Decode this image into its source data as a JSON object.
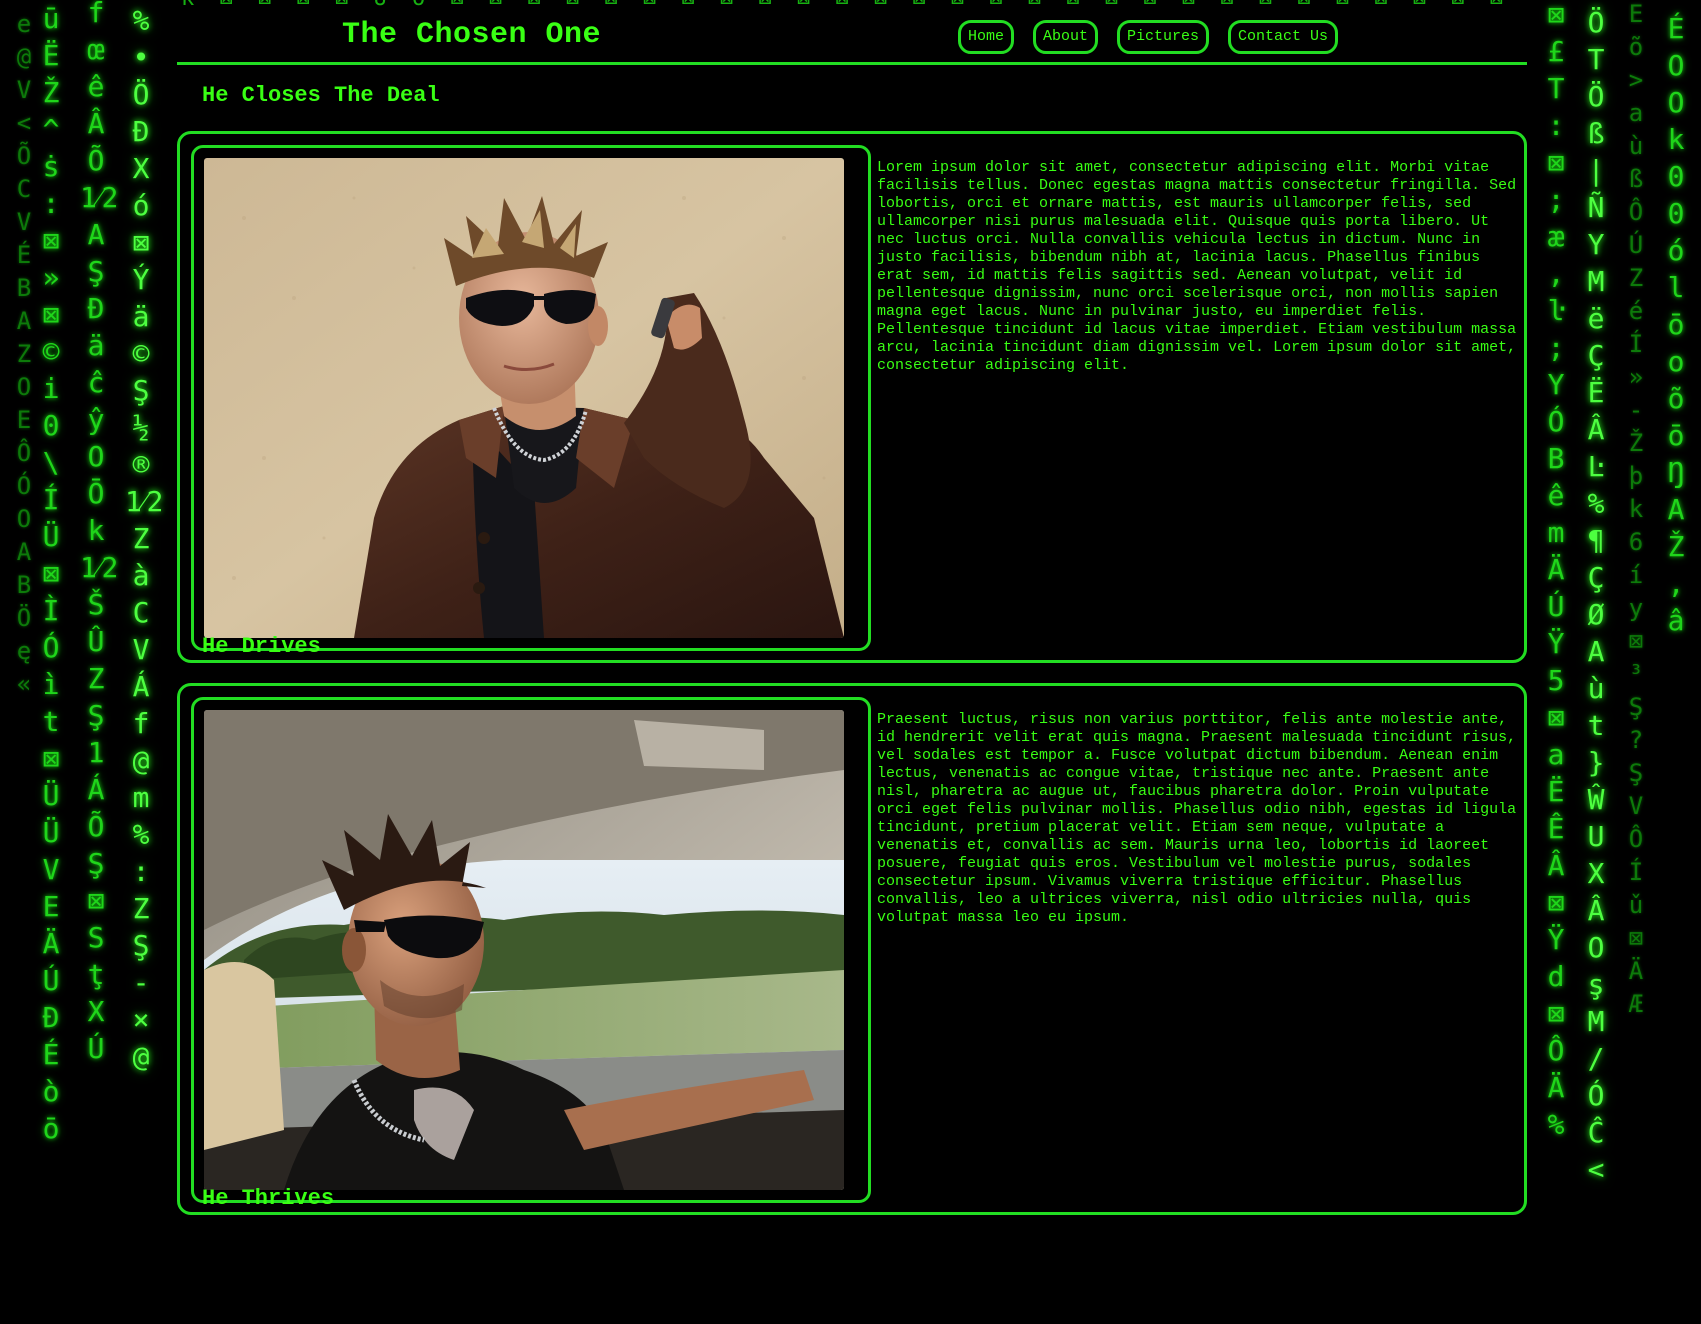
{
  "site": {
    "title": "The Chosen One"
  },
  "nav": {
    "items": [
      {
        "label": "Home"
      },
      {
        "label": "About"
      },
      {
        "label": "Pictures"
      },
      {
        "label": "Contact Us"
      }
    ]
  },
  "sections": [
    {
      "heading": "He Closes The Deal",
      "image": "man in leather jacket on phone",
      "text": "Lorem ipsum dolor sit amet, consectetur adipiscing elit. Morbi vitae facilisis tellus. Donec egestas magna mattis consectetur fringilla. Sed lobortis, orci et ornare mattis, est mauris ullamcorper felis, sed ullamcorper nisi purus malesuada elit. Quisque quis porta libero. Ut nec luctus orci. Nulla convallis vehicula lectus in dictum. Nunc in justo facilisis, bibendum nibh at, lacinia lacus. Phasellus finibus erat sem, id mattis felis sagittis sed. Aenean volutpat, velit id pellentesque dignissim, nunc orci scelerisque orci, non mollis sapien magna eget lacus. Nunc in pulvinar justo, eu imperdiet felis. Pellentesque tincidunt id lacus vitae imperdiet. Etiam vestibulum massa arcu, lacinia tincidunt diam dignissim vel. Lorem ipsum dolor sit amet, consectetur adipiscing elit."
    },
    {
      "heading": "He Drives",
      "image": "man driving car with sunglasses",
      "text": "Praesent luctus, risus non varius porttitor, felis ante molestie ante, id hendrerit velit erat quis magna. Praesent malesuada tincidunt risus, vel sodales est tempor a. Fusce volutpat dictum bibendum. Aenean enim lectus, venenatis ac congue vitae, tristique nec ante. Praesent ante nisl, pharetra ac augue ut, faucibus pharetra dolor. Proin vulputate orci eget felis pulvinar mollis. Phasellus odio nibh, egestas id ligula tincidunt, pretium placerat velit. Etiam sem neque, vulputate a venenatis et, convallis ac sem. Mauris urna leo, lobortis id laoreet posuere, feugiat quis eros. Vestibulum vel molestie purus, sodales consectetur ipsum. Vivamus viverra tristique efficitur. Phasellus convallis, leo a ultrices viverra, nisl odio ultricies nulla, quis volutpat massa leo eu ipsum."
    },
    {
      "heading": "He Thrives"
    }
  ],
  "colors": {
    "accent": "#39ff14",
    "border": "#22dd22",
    "background": "#000000"
  }
}
